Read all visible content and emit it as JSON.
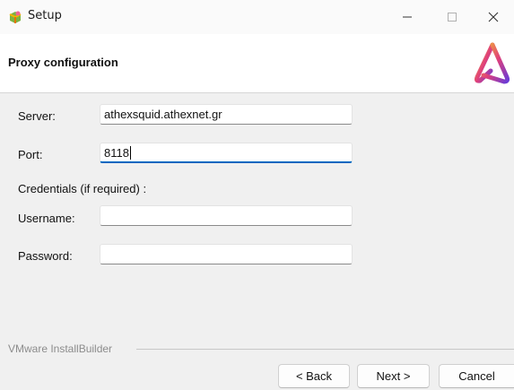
{
  "window": {
    "title": "Setup",
    "minimize_icon": "minimize-icon",
    "maximize_icon": "maximize-icon",
    "close_icon": "close-icon"
  },
  "header": {
    "title": "Proxy configuration",
    "logo_icon": "installer-logo-icon"
  },
  "form": {
    "server": {
      "label": "Server:",
      "value": "athexsquid.athexnet.gr"
    },
    "port": {
      "label": "Port:",
      "value": "8118"
    },
    "credentials_label": "Credentials (if required) :",
    "username": {
      "label": "Username:",
      "value": ""
    },
    "password": {
      "label": "Password:",
      "value": ""
    }
  },
  "footer": {
    "brand": "VMware InstallBuilder",
    "back_label": "< Back",
    "next_label": "Next >",
    "cancel_label": "Cancel"
  },
  "colors": {
    "accent": "#0067c0",
    "logo_gradient": [
      "#f2b233",
      "#e0407a",
      "#6b3bd6"
    ]
  }
}
